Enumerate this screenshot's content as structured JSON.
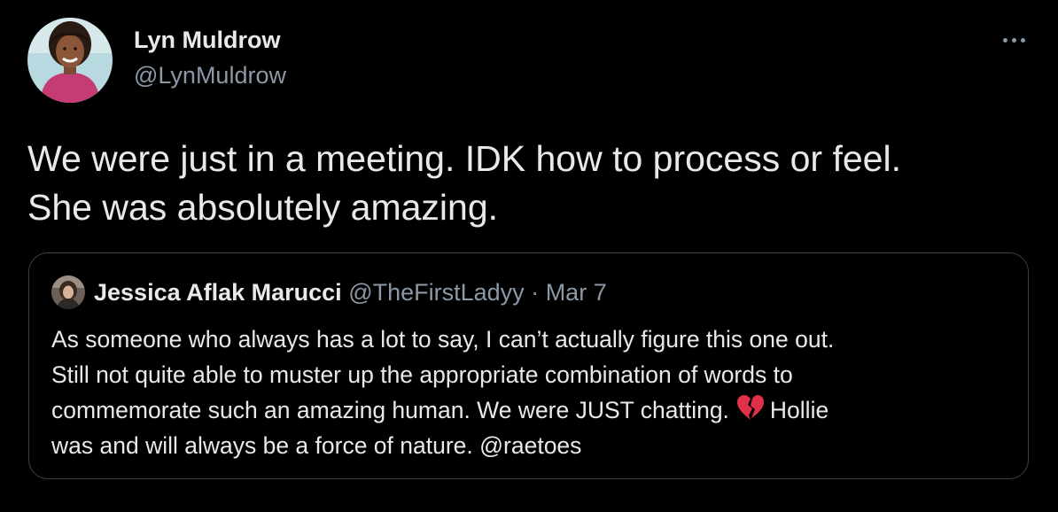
{
  "tweet": {
    "author": {
      "name": "Lyn Muldrow",
      "handle": "@LynMuldrow",
      "avatar_icon": "profile-photo"
    },
    "more_icon": "more-horizontal-icon",
    "text_lines": [
      "We were just in a meeting. IDK how to process or feel.",
      "She was absolutely amazing."
    ]
  },
  "quote": {
    "author": {
      "name": "Jessica Aflak Marucci",
      "handle": "@TheFirstLadyy",
      "separator": "·",
      "date": "Mar 7",
      "avatar_icon": "profile-photo"
    },
    "text_lines": [
      "As someone who always has a lot to say, I can’t actually figure this one out.",
      "Still not quite able to muster up the appropriate combination of words to",
      "commemorate such an amazing human. We were JUST chatting.",
      "Hollie",
      "was and will always be a force of nature. @raetoes"
    ],
    "emoji": "broken-heart-icon"
  },
  "colors": {
    "background": "#000000",
    "primary_text": "#e7e9ea",
    "secondary_text": "#8b98a5",
    "border": "#3e4144",
    "broken_heart": "#e0304a"
  }
}
